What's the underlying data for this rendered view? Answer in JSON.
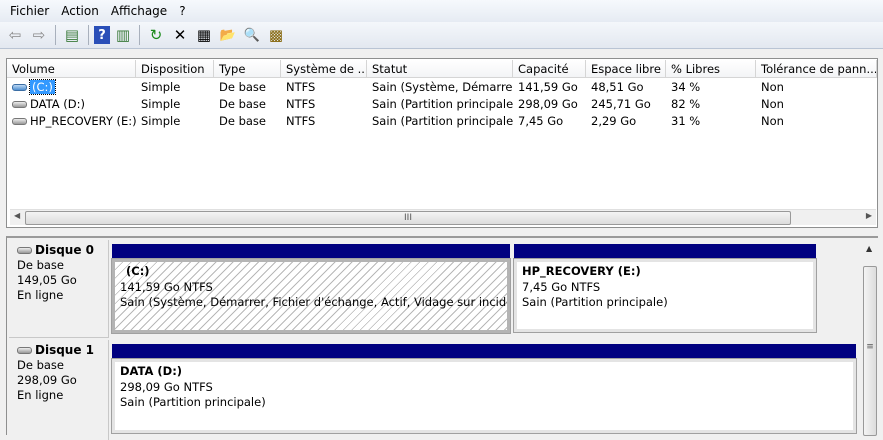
{
  "menu": [
    "Fichier",
    "Action",
    "Affichage",
    "?"
  ],
  "toolbar": {
    "icons": [
      "back-arrow-icon",
      "forward-arrow-icon",
      "console-tree-icon",
      "help-icon",
      "action-pane-icon",
      "refresh-icon",
      "delete-icon",
      "properties-icon",
      "open-icon",
      "explore-icon",
      "disk-settings-icon"
    ],
    "glyphs": [
      "⇦",
      "⇨",
      "▤",
      "?",
      "▥",
      "↻",
      "✕",
      "▦",
      "📂",
      "🔍",
      "▩"
    ]
  },
  "list": {
    "columns": [
      "Volume",
      "Disposition",
      "Type",
      "Système de ...",
      "Statut",
      "Capacité",
      "Espace libre",
      "% Libres",
      "Tolérance de pann..."
    ],
    "rows": [
      [
        "(C:)",
        "Simple",
        "De base",
        "NTFS",
        "Sain (Système, Démarre...",
        "141,59 Go",
        "48,51 Go",
        "34 %",
        "Non"
      ],
      [
        "DATA (D:)",
        "Simple",
        "De base",
        "NTFS",
        "Sain (Partition principale)",
        "298,09 Go",
        "245,71 Go",
        "82 %",
        "Non"
      ],
      [
        "HP_RECOVERY (E:)",
        "Simple",
        "De base",
        "NTFS",
        "Sain (Partition principale)",
        "7,45 Go",
        "2,29 Go",
        "31 %",
        "Non"
      ]
    ],
    "scroll_grip": "III"
  },
  "disks": [
    {
      "name": "Disque 0",
      "type": "De base",
      "size": "149,05 Go",
      "status": "En ligne",
      "partitions": [
        {
          "title": "(C:)",
          "size": "141,59 Go NTFS",
          "status": "Sain (Système, Démarrer, Fichier d'échange, Actif, Vidage sur incident, Partition principale)"
        },
        {
          "title": "HP_RECOVERY  (E:)",
          "size": "7,45 Go NTFS",
          "status": "Sain (Partition principale)"
        }
      ]
    },
    {
      "name": "Disque 1",
      "type": "De base",
      "size": "298,09 Go",
      "status": "En ligne",
      "partitions": [
        {
          "title": "DATA  (D:)",
          "size": "298,09 Go NTFS",
          "status": "Sain (Partition principale)"
        }
      ]
    }
  ],
  "colors": {
    "partition_bar": "#000080",
    "selection": "#3399ff"
  }
}
